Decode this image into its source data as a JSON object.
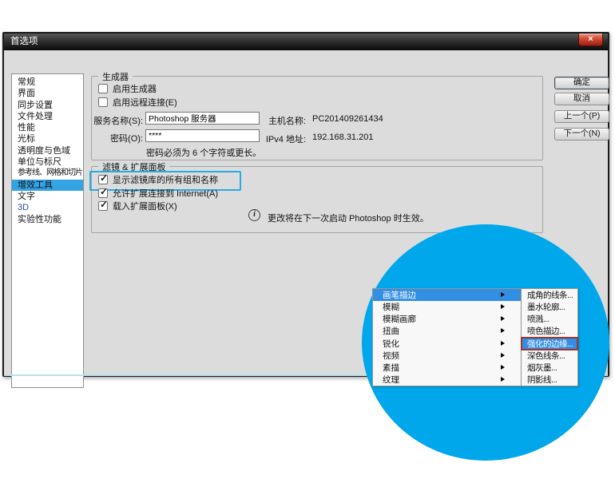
{
  "window": {
    "title": "首选项"
  },
  "glyphs": {
    "close": "×",
    "check": "✓",
    "info": "i"
  },
  "sidebar": {
    "items": [
      {
        "label": "常规"
      },
      {
        "label": "界面"
      },
      {
        "label": "同步设置"
      },
      {
        "label": "文件处理"
      },
      {
        "label": "性能"
      },
      {
        "label": "光标"
      },
      {
        "label": "透明度与色域"
      },
      {
        "label": "单位与标尺"
      },
      {
        "label": "参考线、网格和切片"
      },
      {
        "label": "增效工具",
        "selected": true
      },
      {
        "label": "文字"
      },
      {
        "label": "3D"
      },
      {
        "label": "实验性功能"
      }
    ]
  },
  "buttons": {
    "ok": "确定",
    "cancel": "取消",
    "prev": "上一个(P)",
    "next": "下一个(N)"
  },
  "generator": {
    "title": "生成器",
    "enable_generator": "启用生成器",
    "enable_remote": "启用远程连接(E)",
    "service_label": "服务名称(S):",
    "service_value": "Photoshop 服务器",
    "password_label": "密码(O):",
    "password_value": "****",
    "password_hint": "密码必须为 6 个字符或更长。",
    "host_label": "主机名称:",
    "host_value": "PC201409261434",
    "ip_label": "IPv4 地址:",
    "ip_value": "192.168.31.201"
  },
  "filters": {
    "title": "滤镜 & 扩展面板",
    "show_filter_gallery": "显示滤镜库的所有组和名称",
    "allow_extensions": "允许扩展连接到 Internet(A)",
    "load_extension_panels": "载入扩展面板(X)",
    "info_text": "更改将在下一次启动 Photoshop 时生效。"
  },
  "magnifier": {
    "menu": [
      "画笔描边",
      "模糊",
      "模糊画廊",
      "扭曲",
      "锐化",
      "视频",
      "素描",
      "纹理"
    ],
    "menu_selected": "画笔描边",
    "submenu": [
      "成角的线条...",
      "墨水轮廓...",
      "喷溅...",
      "喷色描边...",
      "强化的边缘...",
      "深色线条...",
      "烟灰墨...",
      "阴影线..."
    ],
    "submenu_selected": "强化的边缘..."
  },
  "colors": {
    "circle": "#00a7ea",
    "menu_selection": "#338fe3",
    "sidebar_selection": "#34a3e4",
    "highlight_box": "#29abe2",
    "submenu_outline": "#a2352a",
    "close_button": "#c9372c"
  }
}
